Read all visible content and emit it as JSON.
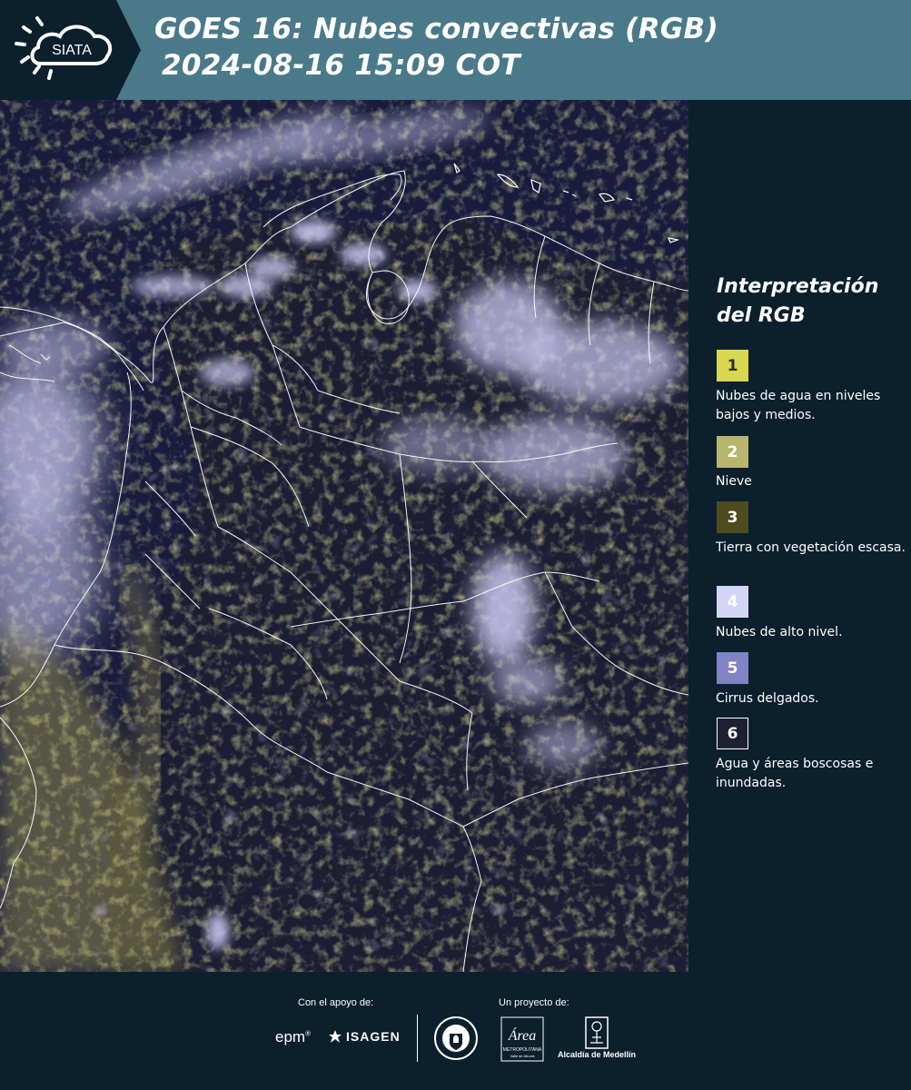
{
  "header": {
    "logo_text": "SIATA",
    "title_line_1": "GOES 16: Nubes convectivas (RGB)",
    "title_line_2": "2024-08-16 15:09 COT"
  },
  "map": {
    "product": "GOES 16 Nubes convectivas RGB",
    "background_color": "#171b3b",
    "border_color": "#ffffff"
  },
  "legend": {
    "title": "Interpretación del RGB",
    "items": [
      {
        "number": "1",
        "color": "#d9d64f",
        "text_color": "#2e2e10",
        "label": "Nubes de agua en niveles bajos y medios."
      },
      {
        "number": "2",
        "color": "#b7b56e",
        "text_color": "#ffffff",
        "label": "Nieve"
      },
      {
        "number": "3",
        "color": "#4e4b1e",
        "text_color": "#ffffff",
        "label": "Tierra con vegetación escasa."
      },
      {
        "number": "4",
        "color": "#d4d4f4",
        "text_color": "#ffffff",
        "label": "Nubes de alto nivel."
      },
      {
        "number": "5",
        "color": "#8282c6",
        "text_color": "#ffffff",
        "label": "Cirrus delgados."
      },
      {
        "number": "6",
        "color": "#1f1f32",
        "text_color": "#ffffff",
        "label": "Agua y áreas boscosas e inundadas."
      }
    ]
  },
  "footer": {
    "support_label": "Con el apoyo de:",
    "project_label": "Un proyecto de:",
    "sponsors": [
      "epm",
      "ISAGEN"
    ],
    "alcaldia_text": "Alcaldía de Medellín",
    "metro_text": "METROPOLITANA",
    "metro_sub": "Valle de Aburrá",
    "metro_title": "Área"
  },
  "colors": {
    "header_bg": "#4a7a8a",
    "panel_bg": "#0b1f2c"
  }
}
